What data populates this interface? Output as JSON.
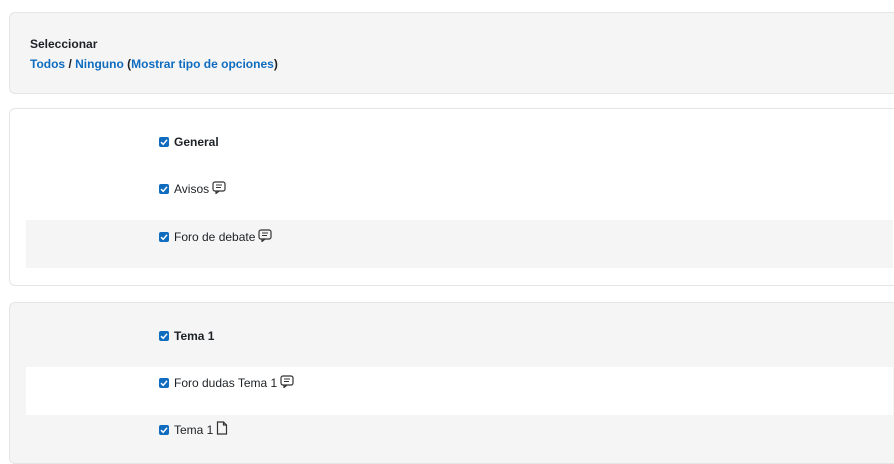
{
  "header": {
    "partial_title": ""
  },
  "select_box": {
    "label": "Seleccionar",
    "all": "Todos",
    "separator": " / ",
    "none": "Ninguno",
    "open_paren": " (",
    "show_options": "Mostrar tipo de opciones",
    "close_paren": ")"
  },
  "sections": {
    "general": {
      "title": "General",
      "items": [
        {
          "label": "Avisos",
          "icon": "forum-icon"
        },
        {
          "label": "Foro de debate",
          "icon": "forum-icon"
        }
      ]
    },
    "tema1": {
      "title": "Tema 1",
      "items": [
        {
          "label": "Foro dudas Tema 1",
          "icon": "forum-icon"
        },
        {
          "label": "Tema 1",
          "icon": "file-icon"
        }
      ]
    }
  },
  "colors": {
    "accent": "#0f6cbf",
    "panel_bg": "#f5f5f5",
    "border": "#e4e5e7"
  }
}
